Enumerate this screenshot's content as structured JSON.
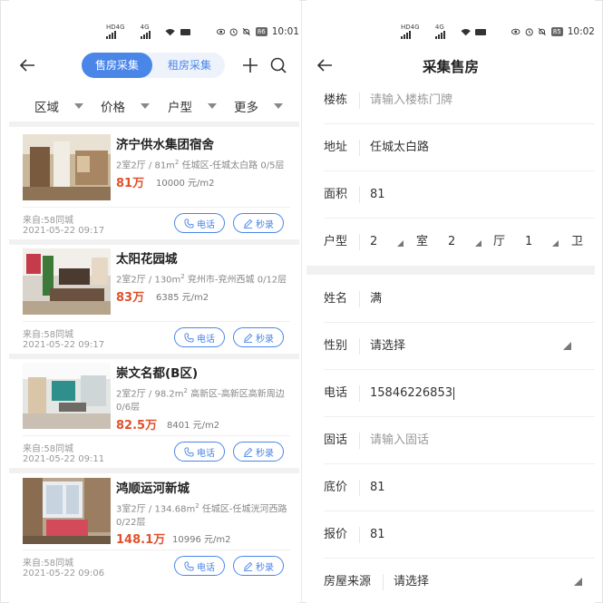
{
  "status_bar": {
    "left": {
      "time": "10:01",
      "battery": "86"
    },
    "right": {
      "time": "10:02",
      "battery": "85"
    },
    "carrier_tags": [
      "HD",
      "HD"
    ],
    "network_tags": [
      "4G",
      "4G"
    ]
  },
  "left_screen": {
    "header": {
      "tabs": [
        {
          "label": "售房采集",
          "active": true
        },
        {
          "label": "租房采集",
          "active": false
        }
      ],
      "icons": [
        "back-arrow-icon",
        "plus-icon",
        "search-icon"
      ]
    },
    "filters": [
      {
        "label": "区域"
      },
      {
        "label": "价格"
      },
      {
        "label": "户型"
      },
      {
        "label": "更多"
      }
    ],
    "listings": [
      {
        "title": "济宁供水集团宿舍",
        "meta_prefix": "2室2厅 / 81m",
        "meta_suffix": " 任城区-任城太白路 0/5层",
        "sup": "2",
        "price": "81万",
        "unit_price": "10000 元/m2",
        "source": "来自:58同城",
        "date": "2021-05-22 09:17",
        "call_label": "电话",
        "record_label": "秒录"
      },
      {
        "title": "太阳花园城",
        "meta_prefix": "2室2厅 / 130m",
        "meta_suffix": " 兖州市-兖州西城 0/12层",
        "sup": "2",
        "price": "83万",
        "unit_price": "6385 元/m2",
        "source": "来自:58同城",
        "date": "2021-05-22 09:17",
        "call_label": "电话",
        "record_label": "秒录"
      },
      {
        "title": "崇文名都(B区)",
        "meta_prefix": "2室2厅 / 98.2m",
        "meta_suffix": " 高新区-高新区高新周边 0/6层",
        "sup": "2",
        "price": "82.5万",
        "unit_price": "8401 元/m2",
        "source": "来自:58同城",
        "date": "2021-05-22 09:11",
        "call_label": "电话",
        "record_label": "秒录"
      },
      {
        "title": "鸿顺运河新城",
        "meta_prefix": "3室2厅 / 134.68m",
        "meta_suffix": " 任城区-任城洸河西路 0/22层",
        "sup": "2",
        "price": "148.1万",
        "unit_price": "10996 元/m2",
        "source": "来自:58同城",
        "date": "2021-05-22 09:06",
        "call_label": "电话",
        "record_label": "秒录"
      }
    ]
  },
  "right_screen": {
    "title": "采集售房",
    "fields": {
      "building": {
        "label": "楼栋",
        "placeholder": "请输入楼栋门牌"
      },
      "address": {
        "label": "地址",
        "value": "任城太白路"
      },
      "area": {
        "label": "面积",
        "value": "81"
      },
      "layout": {
        "label": "户型",
        "rooms": "2",
        "rooms_unit": "室",
        "halls": "2",
        "halls_unit": "厅",
        "baths": "1",
        "baths_unit": "卫"
      },
      "name": {
        "label": "姓名",
        "value": "满"
      },
      "gender": {
        "label": "性别",
        "value": "请选择"
      },
      "phone": {
        "label": "电话",
        "value": "15846226853"
      },
      "landline": {
        "label": "固话",
        "placeholder": "请输入固话"
      },
      "base_price": {
        "label": "底价",
        "value": "81"
      },
      "quote_price": {
        "label": "报价",
        "value": "81"
      },
      "source": {
        "label": "房屋来源",
        "value": "请选择"
      }
    }
  }
}
